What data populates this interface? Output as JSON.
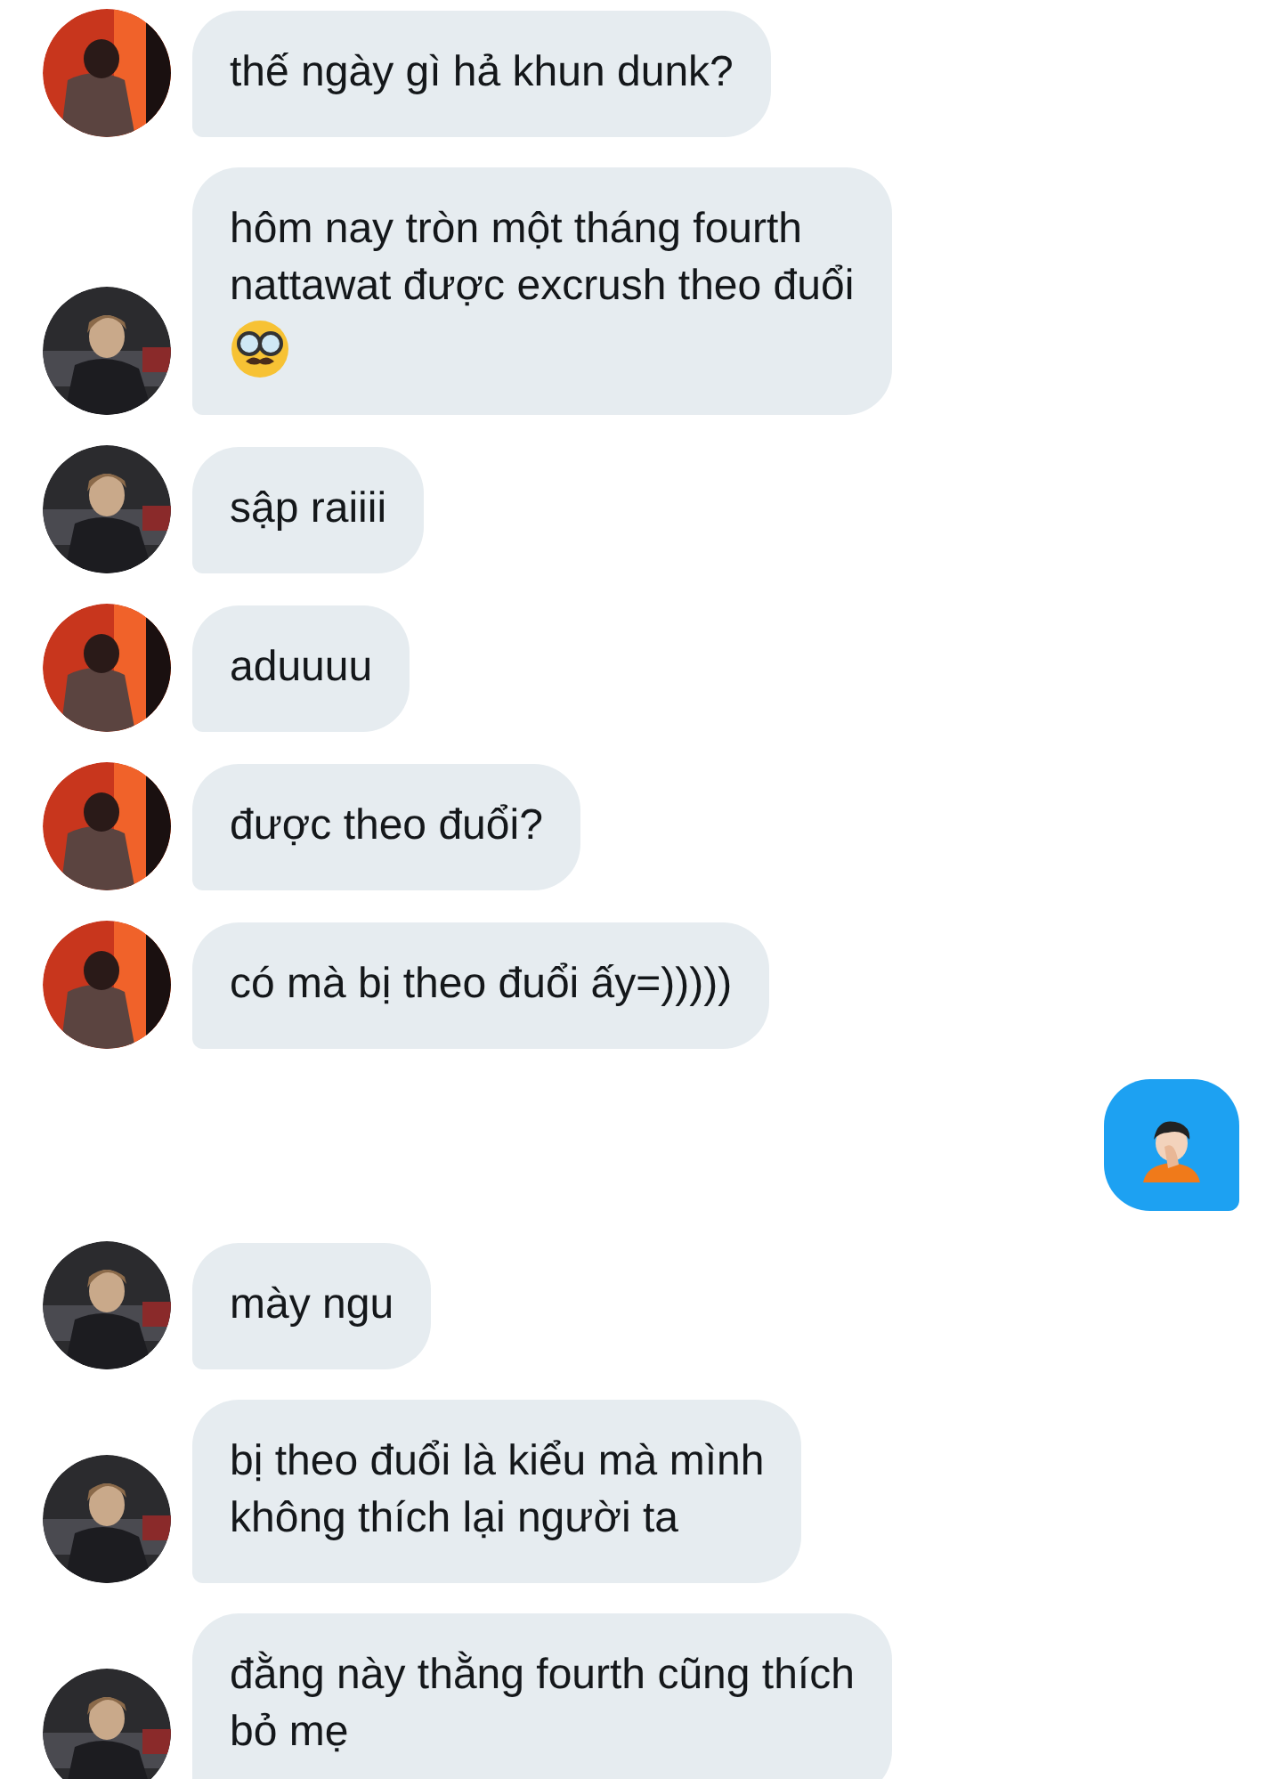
{
  "messages": [
    {
      "kind": "received",
      "color": "#c8361d",
      "text": "thế ngày gì hả khun dunk?"
    },
    {
      "kind": "received",
      "color": "#2b2b2e",
      "text": "hôm nay tròn một tháng fourth\nnattawat được excrush theo đuổi",
      "emoji": true
    },
    {
      "kind": "received",
      "color": "#2b2b2e",
      "text": "sập raiiii"
    },
    {
      "kind": "received",
      "color": "#c8361d",
      "text": "aduuuu"
    },
    {
      "kind": "received",
      "color": "#c8361d",
      "text": "được theo đuổi?"
    },
    {
      "kind": "received",
      "color": "#c8361d",
      "text": "có mà bị theo đuổi ấy=)))))"
    },
    {
      "kind": "sent",
      "emoji": true
    },
    {
      "kind": "received",
      "color": "#2b2b2e",
      "text": "mày ngu"
    },
    {
      "kind": "received",
      "color": "#2b2b2e",
      "text": "bị theo đuổi là kiểu mà mình\nkhông thích lại người ta"
    },
    {
      "kind": "received",
      "color": "#2b2b2e",
      "text": "đằng này thằng fourth cũng thích\nbỏ mẹ"
    }
  ]
}
